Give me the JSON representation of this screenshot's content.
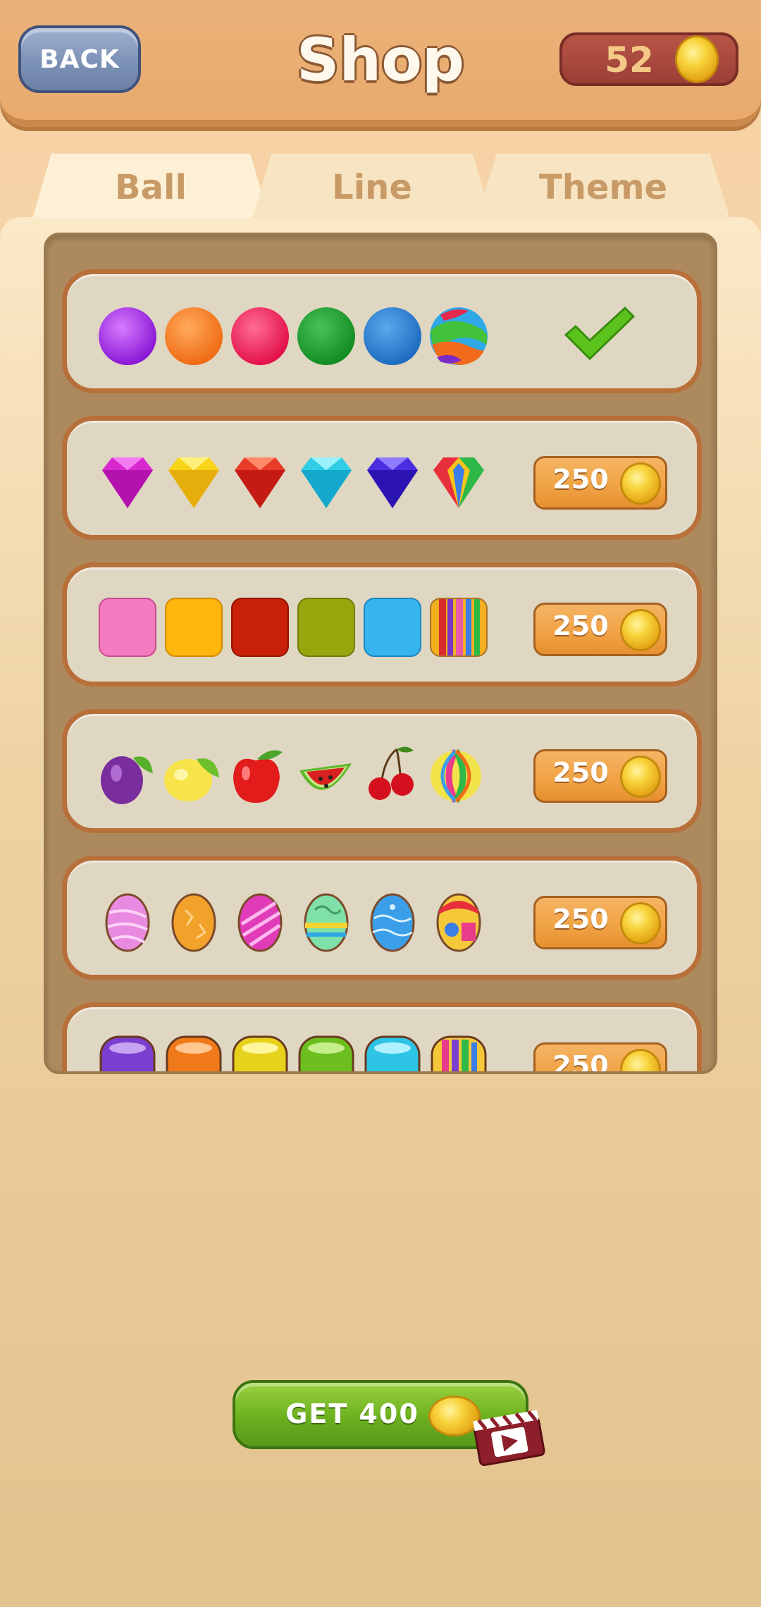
{
  "header": {
    "back_label": "BACK",
    "title": "Shop",
    "coins": "52"
  },
  "tabs": [
    {
      "label": "Ball",
      "active": true
    },
    {
      "label": "Line",
      "active": false
    },
    {
      "label": "Theme",
      "active": false
    }
  ],
  "rows": [
    {
      "set": "plain-balls",
      "status": "selected",
      "items": [
        "purple-ball-icon",
        "orange-ball-icon",
        "pink-ball-icon",
        "green-ball-icon",
        "blue-ball-icon",
        "swirl-ball-icon"
      ]
    },
    {
      "set": "gems",
      "price": "250",
      "items": [
        "magenta-gem-icon",
        "yellow-gem-icon",
        "red-gem-icon",
        "cyan-gem-icon",
        "indigo-gem-icon",
        "rainbow-gem-icon"
      ]
    },
    {
      "set": "squares",
      "price": "250",
      "items": [
        "pink-square-icon",
        "amber-square-icon",
        "red-square-icon",
        "olive-square-icon",
        "sky-square-icon",
        "striped-square-icon"
      ]
    },
    {
      "set": "fruits",
      "price": "250",
      "items": [
        "plum-icon",
        "lemon-icon",
        "apple-icon",
        "watermelon-icon",
        "cherry-icon",
        "beach-ball-icon"
      ]
    },
    {
      "set": "eggs",
      "price": "250",
      "items": [
        "pink-egg-icon",
        "orange-egg-icon",
        "magenta-egg-icon",
        "mint-egg-icon",
        "blue-egg-icon",
        "rainbow-egg-icon"
      ]
    },
    {
      "set": "jars",
      "price": "250",
      "items": [
        "purple-jar-icon",
        "orange-jar-icon",
        "yellow-jar-icon",
        "green-jar-icon",
        "cyan-jar-icon",
        "rainbow-jar-icon"
      ]
    }
  ],
  "reward": {
    "label": "GET 400"
  },
  "colors": {
    "price_button": "#f0a243",
    "get_button": "#6cb01e",
    "back_button": "#7a8fb4",
    "check": "#5cc21e"
  }
}
